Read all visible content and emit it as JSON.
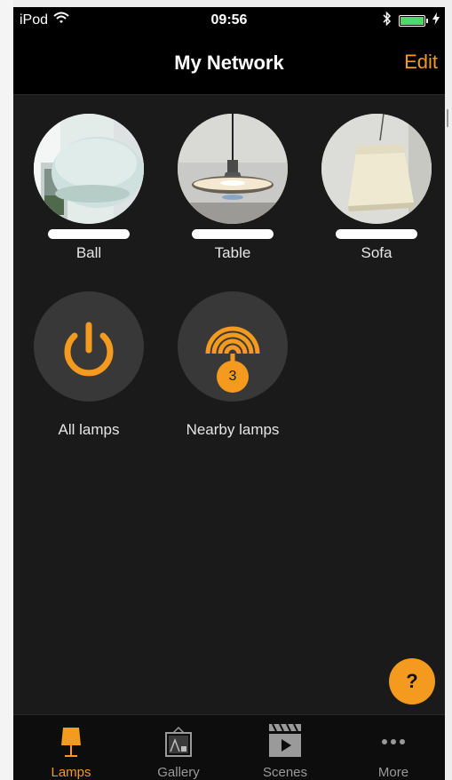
{
  "status_bar": {
    "carrier": "iPod",
    "time": "09:56",
    "wifi_icon": "wifi-icon",
    "bluetooth_icon": "bluetooth-icon",
    "battery_icon": "battery-charging-icon"
  },
  "nav": {
    "title": "My Network",
    "edit_label": "Edit"
  },
  "lamps": [
    {
      "label": "Ball"
    },
    {
      "label": "Table"
    },
    {
      "label": "Sofa"
    }
  ],
  "groups": {
    "all_lamps": {
      "label": "All lamps",
      "icon": "power-icon"
    },
    "nearby_lamps": {
      "label": "Nearby lamps",
      "icon": "signal-icon",
      "badge": "3"
    }
  },
  "help_button": {
    "label": "?"
  },
  "tabs": [
    {
      "label": "Lamps",
      "icon": "lamp-icon",
      "active": true
    },
    {
      "label": "Gallery",
      "icon": "gallery-icon",
      "active": false
    },
    {
      "label": "Scenes",
      "icon": "scenes-icon",
      "active": false
    },
    {
      "label": "More",
      "icon": "more-icon",
      "active": false
    }
  ],
  "colors": {
    "accent": "#f39a1f",
    "background": "#1a1a1a",
    "bar": "#000000"
  }
}
